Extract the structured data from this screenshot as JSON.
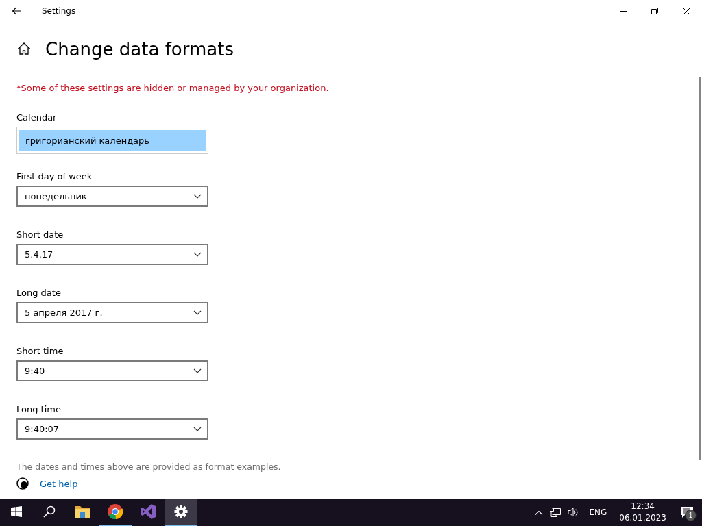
{
  "window": {
    "title": "Settings"
  },
  "page": {
    "title": "Change data formats",
    "notice": "*Some of these settings are hidden or managed by your organization.",
    "fields": [
      {
        "label": "Calendar",
        "value": "григорианский календарь",
        "kind": "locked"
      },
      {
        "label": "First day of week",
        "value": "понедельник",
        "kind": "dropdown"
      },
      {
        "label": "Short date",
        "value": "5.4.17",
        "kind": "dropdown"
      },
      {
        "label": "Long date",
        "value": "5 апреля 2017 г.",
        "kind": "dropdown"
      },
      {
        "label": "Short time",
        "value": "9:40",
        "kind": "dropdown"
      },
      {
        "label": "Long time",
        "value": "9:40:07",
        "kind": "dropdown"
      }
    ],
    "footnote": "The dates and times above are provided as format examples.",
    "help_link": "Get help"
  },
  "taskbar": {
    "apps": [
      {
        "kind": "start",
        "running": false,
        "selected": false
      },
      {
        "kind": "search",
        "running": false,
        "selected": false
      },
      {
        "kind": "folder",
        "running": false,
        "selected": false
      },
      {
        "kind": "browser",
        "running": true,
        "selected": false
      },
      {
        "kind": "studio",
        "running": false,
        "selected": false
      },
      {
        "kind": "settings",
        "running": true,
        "selected": true
      }
    ],
    "language": "ENG",
    "time": "12:34",
    "date": "06.01.2023",
    "notifications": "1"
  }
}
